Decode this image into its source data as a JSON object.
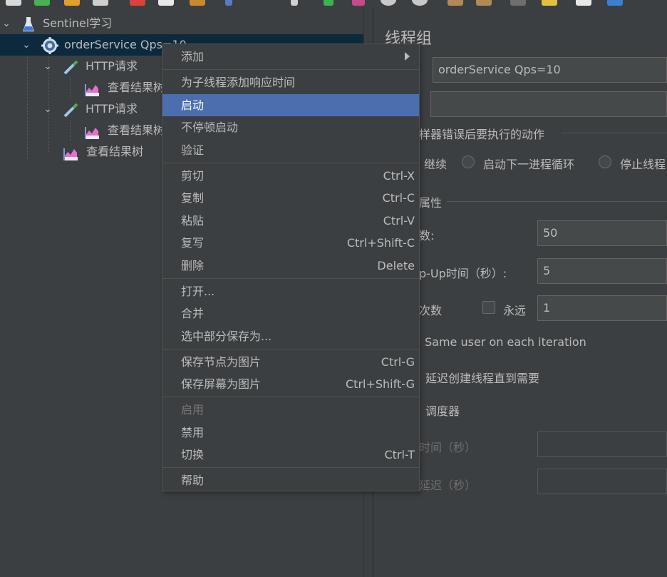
{
  "tree": {
    "items": [
      {
        "label": "Sentinel学习",
        "icon": "test-plan-flask-icon"
      },
      {
        "label": "orderService Qps=10",
        "icon": "thread-group-gear-icon"
      },
      {
        "label": "HTTP请求",
        "icon": "http-sampler-pipette-icon"
      },
      {
        "label": "查看结果树",
        "icon": "result-tree-listener-icon"
      },
      {
        "label": "HTTP请求",
        "icon": "http-sampler-pipette-icon"
      },
      {
        "label": "查看结果树",
        "icon": "result-tree-listener-icon"
      },
      {
        "label": "查看结果树",
        "icon": "result-tree-listener-icon"
      }
    ]
  },
  "panel": {
    "title": "线程组",
    "name_value": "orderService Qps=10",
    "comment_value": "",
    "error_action_title": "样器错误后要执行的动作",
    "radio_continue": "继续",
    "radio_next_loop": "启动下一进程循环",
    "radio_stop_thread": "停止线程",
    "props_title": "属性",
    "threads_label": "数:",
    "threads_value": "50",
    "rampup_label": "p-Up时间（秒）:",
    "rampup_value": "5",
    "loop_label": "次数",
    "forever_label": "永远",
    "loop_value": "1",
    "same_user_label": "Same user on each iteration",
    "delay_create_label": "延迟创建线程直到需要",
    "scheduler_label": "调度器",
    "duration_label": "时间（秒）",
    "startup_delay_label": "延迟（秒）"
  },
  "menu": {
    "items": [
      {
        "label": "添加",
        "shortcut": "",
        "submenu": true
      },
      {
        "label": "为子线程添加响应时间",
        "shortcut": ""
      },
      {
        "label": "启动",
        "shortcut": "",
        "highlighted": true
      },
      {
        "label": "不停顿启动",
        "shortcut": ""
      },
      {
        "label": "验证",
        "shortcut": ""
      },
      {
        "label": "剪切",
        "shortcut": "Ctrl-X"
      },
      {
        "label": "复制",
        "shortcut": "Ctrl-C"
      },
      {
        "label": "粘贴",
        "shortcut": "Ctrl-V"
      },
      {
        "label": "复写",
        "shortcut": "Ctrl+Shift-C"
      },
      {
        "label": "删除",
        "shortcut": "Delete"
      },
      {
        "label": "打开...",
        "shortcut": ""
      },
      {
        "label": "合并",
        "shortcut": ""
      },
      {
        "label": "选中部分保存为...",
        "shortcut": ""
      },
      {
        "label": "保存节点为图片",
        "shortcut": "Ctrl-G"
      },
      {
        "label": "保存屏幕为图片",
        "shortcut": "Ctrl+Shift-G"
      },
      {
        "label": "启用",
        "shortcut": "",
        "disabled": true
      },
      {
        "label": "禁用",
        "shortcut": ""
      },
      {
        "label": "切换",
        "shortcut": "Ctrl-T"
      },
      {
        "label": "帮助",
        "shortcut": ""
      }
    ]
  },
  "colors": {
    "background": "#3c3f41",
    "selection": "#0d293e",
    "menu_highlight": "#4b6eaf",
    "text": "#bbbbbb",
    "disabled_text": "#777777"
  }
}
